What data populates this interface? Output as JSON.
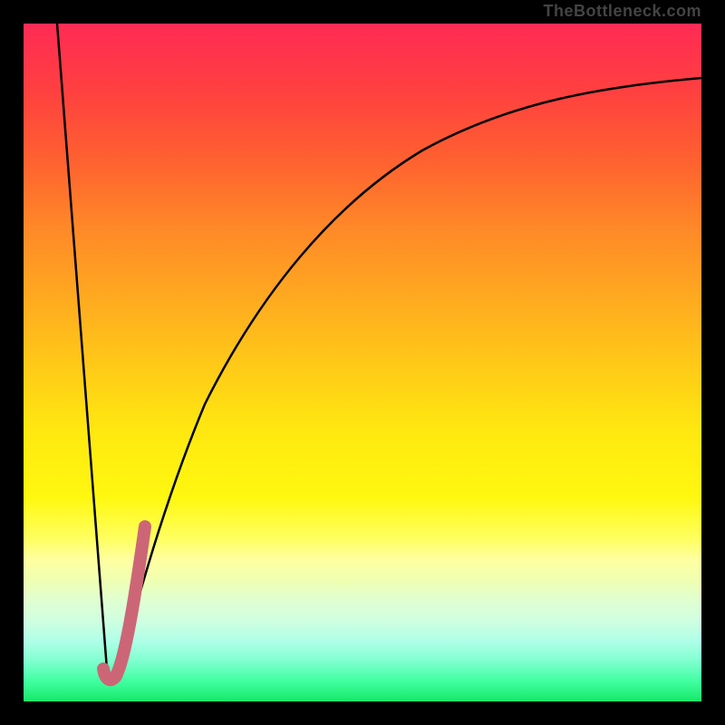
{
  "watermark": "TheBottleneck.com",
  "colors": {
    "background": "#000000",
    "curve": "#000000",
    "highlight": "#CC6677"
  },
  "chart_data": {
    "type": "line",
    "title": "",
    "xlabel": "",
    "ylabel": "",
    "xlim": [
      0,
      100
    ],
    "ylim": [
      0,
      100
    ],
    "series": [
      {
        "name": "left-descent",
        "x": [
          5,
          12.5
        ],
        "y": [
          100,
          3
        ]
      },
      {
        "name": "right-curve",
        "x": [
          12.5,
          13.4,
          15,
          17,
          20,
          24,
          28,
          33,
          38,
          44,
          50,
          57,
          65,
          74,
          84,
          100
        ],
        "y": [
          3,
          3.5,
          8,
          15,
          25,
          37,
          47,
          56,
          63.5,
          70,
          75,
          79,
          82.5,
          85.3,
          87.6,
          90
        ]
      },
      {
        "name": "highlight",
        "x": [
          12.0,
          12.3,
          12.7,
          13.2,
          13.7,
          14.3,
          15.1,
          16.0,
          17.0,
          18.0
        ],
        "y": [
          5,
          3.5,
          3.2,
          4,
          6,
          9,
          13,
          18,
          23,
          28
        ]
      }
    ]
  }
}
